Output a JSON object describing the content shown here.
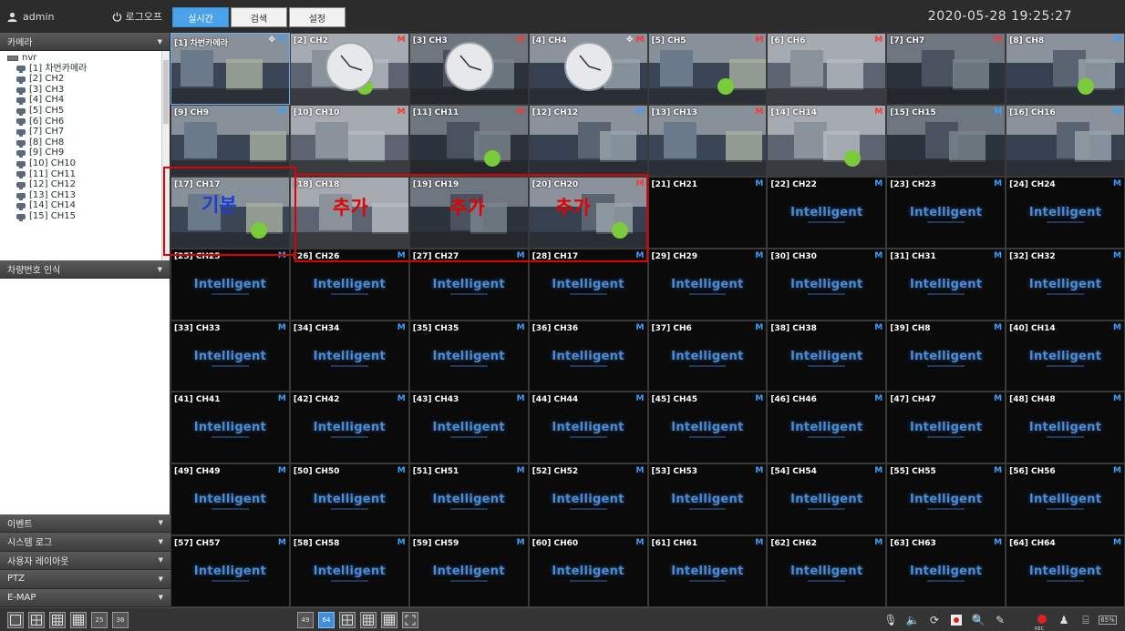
{
  "user": {
    "name": "admin",
    "logout_label": "로그오프"
  },
  "tabs": [
    "실시간",
    "검색",
    "설정"
  ],
  "datetime": "2020-05-28 19:25:27",
  "sidebar": {
    "camera_panel": "카메라",
    "tree_root": "nvr",
    "channels": [
      "[1] 차번카메라",
      "[2] CH2",
      "[3] CH3",
      "[4] CH4",
      "[5] CH5",
      "[6] CH6",
      "[7] CH7",
      "[8] CH8",
      "[9] CH9",
      "[10] CH10",
      "[11] CH11",
      "[12] CH12",
      "[13] CH13",
      "[14] CH14",
      "[15] CH15"
    ],
    "plate_panel": "차량번호 인식",
    "bottom_panels": [
      "이벤트",
      "시스템 로그",
      "사용자 레이아웃",
      "PTZ",
      "E-MAP"
    ]
  },
  "tiles": [
    {
      "label": "[1] 차번카메라",
      "mark": "M",
      "kind": "feed",
      "markColor": "#3aa0ff",
      "active": true,
      "move": true
    },
    {
      "label": "[2] CH2",
      "mark": "M",
      "kind": "feed",
      "markColor": "#ff3333"
    },
    {
      "label": "[3] CH3",
      "mark": "M",
      "kind": "feed",
      "markColor": "#ff3333"
    },
    {
      "label": "[4] CH4",
      "mark": "M",
      "kind": "feed",
      "markColor": "#ff3333",
      "move": true
    },
    {
      "label": "[5] CH5",
      "mark": "M",
      "kind": "feed",
      "markColor": "#ff3333"
    },
    {
      "label": "[6] CH6",
      "mark": "M",
      "kind": "feed",
      "markColor": "#ff3333"
    },
    {
      "label": "[7] CH7",
      "mark": "M",
      "kind": "feed",
      "markColor": "#ff3333"
    },
    {
      "label": "[8] CH8",
      "mark": "M",
      "kind": "feed",
      "markColor": "#3aa0ff"
    },
    {
      "label": "[9] CH9",
      "mark": "M",
      "kind": "feed",
      "markColor": "#3aa0ff"
    },
    {
      "label": "[10] CH10",
      "mark": "M",
      "kind": "feed",
      "markColor": "#ff3333"
    },
    {
      "label": "[11] CH11",
      "mark": "M",
      "kind": "feed",
      "markColor": "#ff3333"
    },
    {
      "label": "[12] CH12",
      "mark": "M",
      "kind": "feed",
      "markColor": "#3aa0ff"
    },
    {
      "label": "[13] CH13",
      "mark": "M",
      "kind": "feed",
      "markColor": "#ff3333"
    },
    {
      "label": "[14] CH14",
      "mark": "M",
      "kind": "feed",
      "markColor": "#ff3333"
    },
    {
      "label": "[15] CH15",
      "mark": "M",
      "kind": "feed",
      "markColor": "#3aa0ff"
    },
    {
      "label": "[16] CH16",
      "mark": "M",
      "kind": "feed",
      "markColor": "#3aa0ff"
    },
    {
      "label": "[17] CH17",
      "mark": "",
      "kind": "feed",
      "markColor": "#ff3333"
    },
    {
      "label": "[18] CH18",
      "mark": "",
      "kind": "feed",
      "markColor": "#ff3333"
    },
    {
      "label": "[19] CH19",
      "mark": "",
      "kind": "feed",
      "markColor": "#ff3333"
    },
    {
      "label": "[20] CH20",
      "mark": "M",
      "kind": "feed",
      "markColor": "#ff3333"
    },
    {
      "label": "[21] CH21",
      "mark": "M",
      "kind": "blank",
      "markColor": "#3aa0ff"
    },
    {
      "label": "[22] CH22",
      "mark": "M",
      "kind": "logo",
      "markColor": "#3aa0ff"
    },
    {
      "label": "[23] CH23",
      "mark": "M",
      "kind": "logo",
      "markColor": "#3aa0ff"
    },
    {
      "label": "[24] CH24",
      "mark": "M",
      "kind": "logo",
      "markColor": "#3aa0ff"
    },
    {
      "label": "[25] CH25",
      "mark": "M",
      "kind": "logo",
      "markColor": "#3aa0ff"
    },
    {
      "label": "[26] CH26",
      "mark": "M",
      "kind": "logo",
      "markColor": "#3aa0ff"
    },
    {
      "label": "[27] CH27",
      "mark": "M",
      "kind": "logo",
      "markColor": "#3aa0ff"
    },
    {
      "label": "[28] CH17",
      "mark": "M",
      "kind": "logo",
      "markColor": "#3aa0ff"
    },
    {
      "label": "[29] CH29",
      "mark": "M",
      "kind": "logo",
      "markColor": "#3aa0ff"
    },
    {
      "label": "[30] CH30",
      "mark": "M",
      "kind": "logo",
      "markColor": "#3aa0ff"
    },
    {
      "label": "[31] CH31",
      "mark": "M",
      "kind": "logo",
      "markColor": "#3aa0ff"
    },
    {
      "label": "[32] CH32",
      "mark": "M",
      "kind": "logo",
      "markColor": "#3aa0ff"
    },
    {
      "label": "[33] CH33",
      "mark": "M",
      "kind": "logo",
      "markColor": "#3aa0ff"
    },
    {
      "label": "[34] CH34",
      "mark": "M",
      "kind": "logo",
      "markColor": "#3aa0ff"
    },
    {
      "label": "[35] CH35",
      "mark": "M",
      "kind": "logo",
      "markColor": "#3aa0ff"
    },
    {
      "label": "[36] CH36",
      "mark": "M",
      "kind": "logo",
      "markColor": "#3aa0ff"
    },
    {
      "label": "[37] CH6",
      "mark": "M",
      "kind": "logo",
      "markColor": "#3aa0ff"
    },
    {
      "label": "[38] CH38",
      "mark": "M",
      "kind": "logo",
      "markColor": "#3aa0ff"
    },
    {
      "label": "[39] CH8",
      "mark": "M",
      "kind": "logo",
      "markColor": "#3aa0ff"
    },
    {
      "label": "[40] CH14",
      "mark": "M",
      "kind": "logo",
      "markColor": "#3aa0ff"
    },
    {
      "label": "[41] CH41",
      "mark": "M",
      "kind": "logo",
      "markColor": "#3aa0ff"
    },
    {
      "label": "[42] CH42",
      "mark": "M",
      "kind": "logo",
      "markColor": "#3aa0ff"
    },
    {
      "label": "[43] CH43",
      "mark": "M",
      "kind": "logo",
      "markColor": "#3aa0ff"
    },
    {
      "label": "[44] CH44",
      "mark": "M",
      "kind": "logo",
      "markColor": "#3aa0ff"
    },
    {
      "label": "[45] CH45",
      "mark": "M",
      "kind": "logo",
      "markColor": "#3aa0ff"
    },
    {
      "label": "[46] CH46",
      "mark": "M",
      "kind": "logo",
      "markColor": "#3aa0ff"
    },
    {
      "label": "[47] CH47",
      "mark": "M",
      "kind": "logo",
      "markColor": "#3aa0ff"
    },
    {
      "label": "[48] CH48",
      "mark": "M",
      "kind": "logo",
      "markColor": "#3aa0ff"
    },
    {
      "label": "[49] CH49",
      "mark": "M",
      "kind": "logo",
      "markColor": "#3aa0ff"
    },
    {
      "label": "[50] CH50",
      "mark": "M",
      "kind": "logo",
      "markColor": "#3aa0ff"
    },
    {
      "label": "[51] CH51",
      "mark": "M",
      "kind": "logo",
      "markColor": "#3aa0ff"
    },
    {
      "label": "[52] CH52",
      "mark": "M",
      "kind": "logo",
      "markColor": "#3aa0ff"
    },
    {
      "label": "[53] CH53",
      "mark": "M",
      "kind": "logo",
      "markColor": "#3aa0ff"
    },
    {
      "label": "[54] CH54",
      "mark": "M",
      "kind": "logo",
      "markColor": "#3aa0ff"
    },
    {
      "label": "[55] CH55",
      "mark": "M",
      "kind": "logo",
      "markColor": "#3aa0ff"
    },
    {
      "label": "[56] CH56",
      "mark": "M",
      "kind": "logo",
      "markColor": "#3aa0ff"
    },
    {
      "label": "[57] CH57",
      "mark": "M",
      "kind": "logo",
      "markColor": "#3aa0ff"
    },
    {
      "label": "[58] CH58",
      "mark": "M",
      "kind": "logo",
      "markColor": "#3aa0ff"
    },
    {
      "label": "[59] CH59",
      "mark": "M",
      "kind": "logo",
      "markColor": "#3aa0ff"
    },
    {
      "label": "[60] CH60",
      "mark": "M",
      "kind": "logo",
      "markColor": "#3aa0ff"
    },
    {
      "label": "[61] CH61",
      "mark": "M",
      "kind": "logo",
      "markColor": "#3aa0ff"
    },
    {
      "label": "[62] CH62",
      "mark": "M",
      "kind": "logo",
      "markColor": "#3aa0ff"
    },
    {
      "label": "[63] CH63",
      "mark": "M",
      "kind": "logo",
      "markColor": "#3aa0ff"
    },
    {
      "label": "[64] CH64",
      "mark": "M",
      "kind": "logo",
      "markColor": "#3aa0ff"
    }
  ],
  "placeholder_logo": "Intelligent",
  "annotations": {
    "base_label": "기본",
    "add_labels": [
      "추가",
      "추가",
      "추가"
    ]
  },
  "layout_buttons": [
    "1",
    "4",
    "9",
    "16",
    "25",
    "36",
    "49",
    "64",
    "L1",
    "L2",
    "L3",
    "full"
  ],
  "selected_layout": "64",
  "tool_icons": [
    "microphone-icon",
    "speaker-icon",
    "refresh-icon",
    "record-icon",
    "search-zoom-icon",
    "snapshot-icon",
    "rec-status-icon",
    "user-status-icon",
    "network-icon",
    "hdd-icon"
  ],
  "rec_label": "REC",
  "hdd_label": "65%",
  "colors": {
    "accent": "#4aa3e8",
    "annotation": "#e00000",
    "annotation_blue": "#1a3fd8",
    "mark_red": "#ff3333",
    "mark_blue": "#3aa0ff"
  }
}
